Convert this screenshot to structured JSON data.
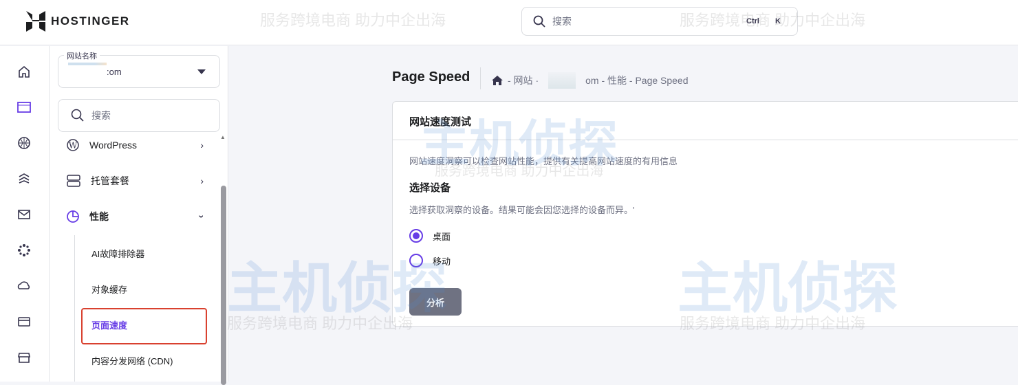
{
  "header": {
    "brand": "HOSTINGER",
    "search_placeholder": "搜索",
    "shortcut_ctrl": "Ctrl",
    "shortcut_key": "K"
  },
  "rail": [
    "home-icon",
    "website-icon",
    "globe-icon",
    "layers-icon",
    "mail-icon",
    "loader-icon",
    "cloud-drive-icon",
    "billing-card-icon",
    "store-icon"
  ],
  "sidebar": {
    "site_label": "网站名称",
    "site_value": ":om",
    "search_placeholder": "搜索",
    "items": [
      {
        "label": "WordPress"
      },
      {
        "label": "托管套餐"
      },
      {
        "label": "性能"
      }
    ],
    "sub_items": [
      {
        "label": "AI故障排除器"
      },
      {
        "label": "对象缓存"
      },
      {
        "label": "页面速度"
      },
      {
        "label": "内容分发网络 (CDN)"
      }
    ]
  },
  "page": {
    "title": "Page Speed",
    "breadcrumb": {
      "a": "- 网站 ·",
      "b": "om - 性能 - Page Speed"
    }
  },
  "card": {
    "title": "网站速度测试",
    "description": "网站速度洞察可以检查网站性能，提供有关提高网站速度的有用信息",
    "section_title": "选择设备",
    "section_desc": "选择获取洞察的设备。结果可能会因您选择的设备而异。'",
    "options": [
      {
        "label": "桌面",
        "selected": true
      },
      {
        "label": "移动",
        "selected": false
      }
    ],
    "analyze_label": "分析"
  },
  "watermark": {
    "brand": "主机侦探",
    "slogan": "服务跨境电商 助力中企出海"
  },
  "colors": {
    "accent": "#673de6",
    "highlight": "#d9412f"
  }
}
